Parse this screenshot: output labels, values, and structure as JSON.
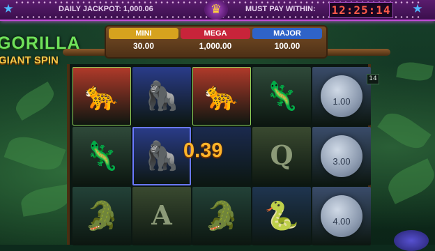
{
  "header": {
    "daily_jackpot": "DAILY JACKPOT: 1,000.06",
    "must_pay_label": "MUST PAY WITHIN:",
    "timer": "12:25:14"
  },
  "logo": {
    "line1": "GORILLA",
    "line2": "GIANT SPIN"
  },
  "jackpots": [
    {
      "name": "MINI",
      "amount": "30.00",
      "color": "#d6a21e"
    },
    {
      "name": "MEGA",
      "amount": "1,000.00",
      "color": "#c8243a"
    },
    {
      "name": "MAJOR",
      "amount": "100.00",
      "color": "#2f63c8"
    }
  ],
  "win_value": "0.39",
  "lines_badge": "14",
  "reels": [
    [
      "jaguar",
      "chameleon",
      "crocodile"
    ],
    [
      "gorilla",
      "gorilla",
      "letter-a"
    ],
    [
      "jaguar",
      "gorilla-dim",
      "crocodile"
    ],
    [
      "chameleon",
      "letter-q",
      "snake"
    ],
    [
      "moon",
      "moon",
      "moon"
    ]
  ],
  "moon_values": [
    "1.00",
    "3.00",
    "4.00"
  ],
  "symbol_colors": {
    "jaguar": "#b23a2a",
    "gorilla": "#2a3c8a",
    "chameleon": "#2f4a3a",
    "crocodile": "#234238",
    "letter": "#3a4a30",
    "snake": "#1f3550",
    "moon": "#3a4c6a"
  }
}
